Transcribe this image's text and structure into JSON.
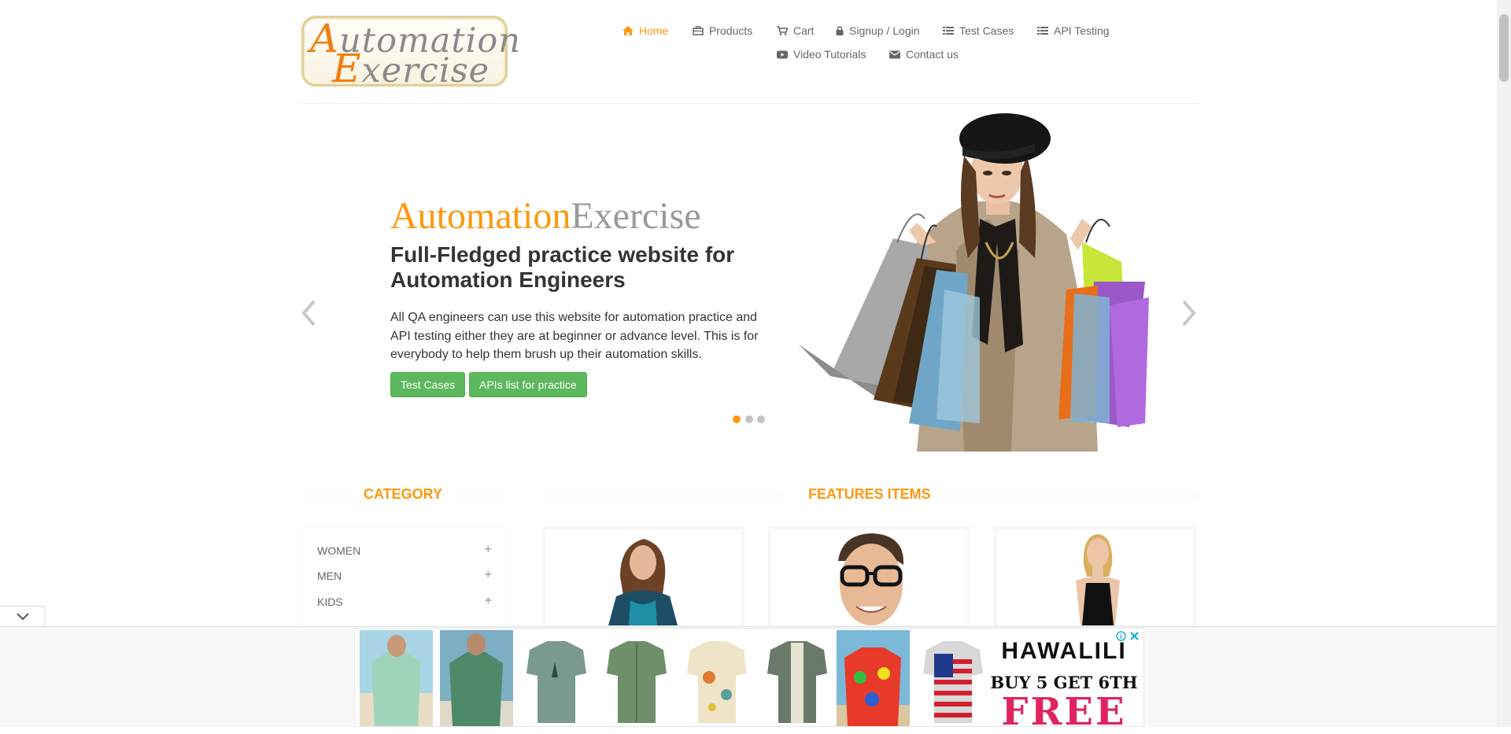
{
  "logo": {
    "line1_cap": "A",
    "line1_rest": "utomation",
    "line2_cap": "E",
    "line2_rest": "xercise"
  },
  "nav": {
    "home": "Home",
    "products": "Products",
    "cart": "Cart",
    "signup": "Signup / Login",
    "test_cases": "Test Cases",
    "api_testing": "API Testing",
    "video_tutorials": "Video Tutorials",
    "contact": "Contact us"
  },
  "slider": {
    "brand_orange": "Automation",
    "brand_grey": "Exercise",
    "headline": "Full-Fledged practice website for Automation Engineers",
    "description": "All QA engineers can use this website for automation practice and API testing either they are at beginner or advance level. This is for everybody to help them brush up their automation skills.",
    "btn_test_cases": "Test Cases",
    "btn_apis": "APIs list for practice",
    "active_slide": 1,
    "slide_count": 3
  },
  "category": {
    "title": "CATEGORY",
    "items": [
      {
        "label": "WOMEN"
      },
      {
        "label": "MEN"
      },
      {
        "label": "KIDS"
      }
    ]
  },
  "features": {
    "title": "FEATURES ITEMS"
  },
  "ad": {
    "brand": "HAWALILI",
    "offer_line1": "BUY 5 GET 6TH",
    "offer_line2": "FREE",
    "info_icon": "info-icon",
    "close_icon": "close-icon"
  },
  "colors": {
    "accent": "#fe980f",
    "text": "#696763",
    "dark_text": "#363432",
    "green": "#5cb85c",
    "ad_red": "#e0245e"
  }
}
